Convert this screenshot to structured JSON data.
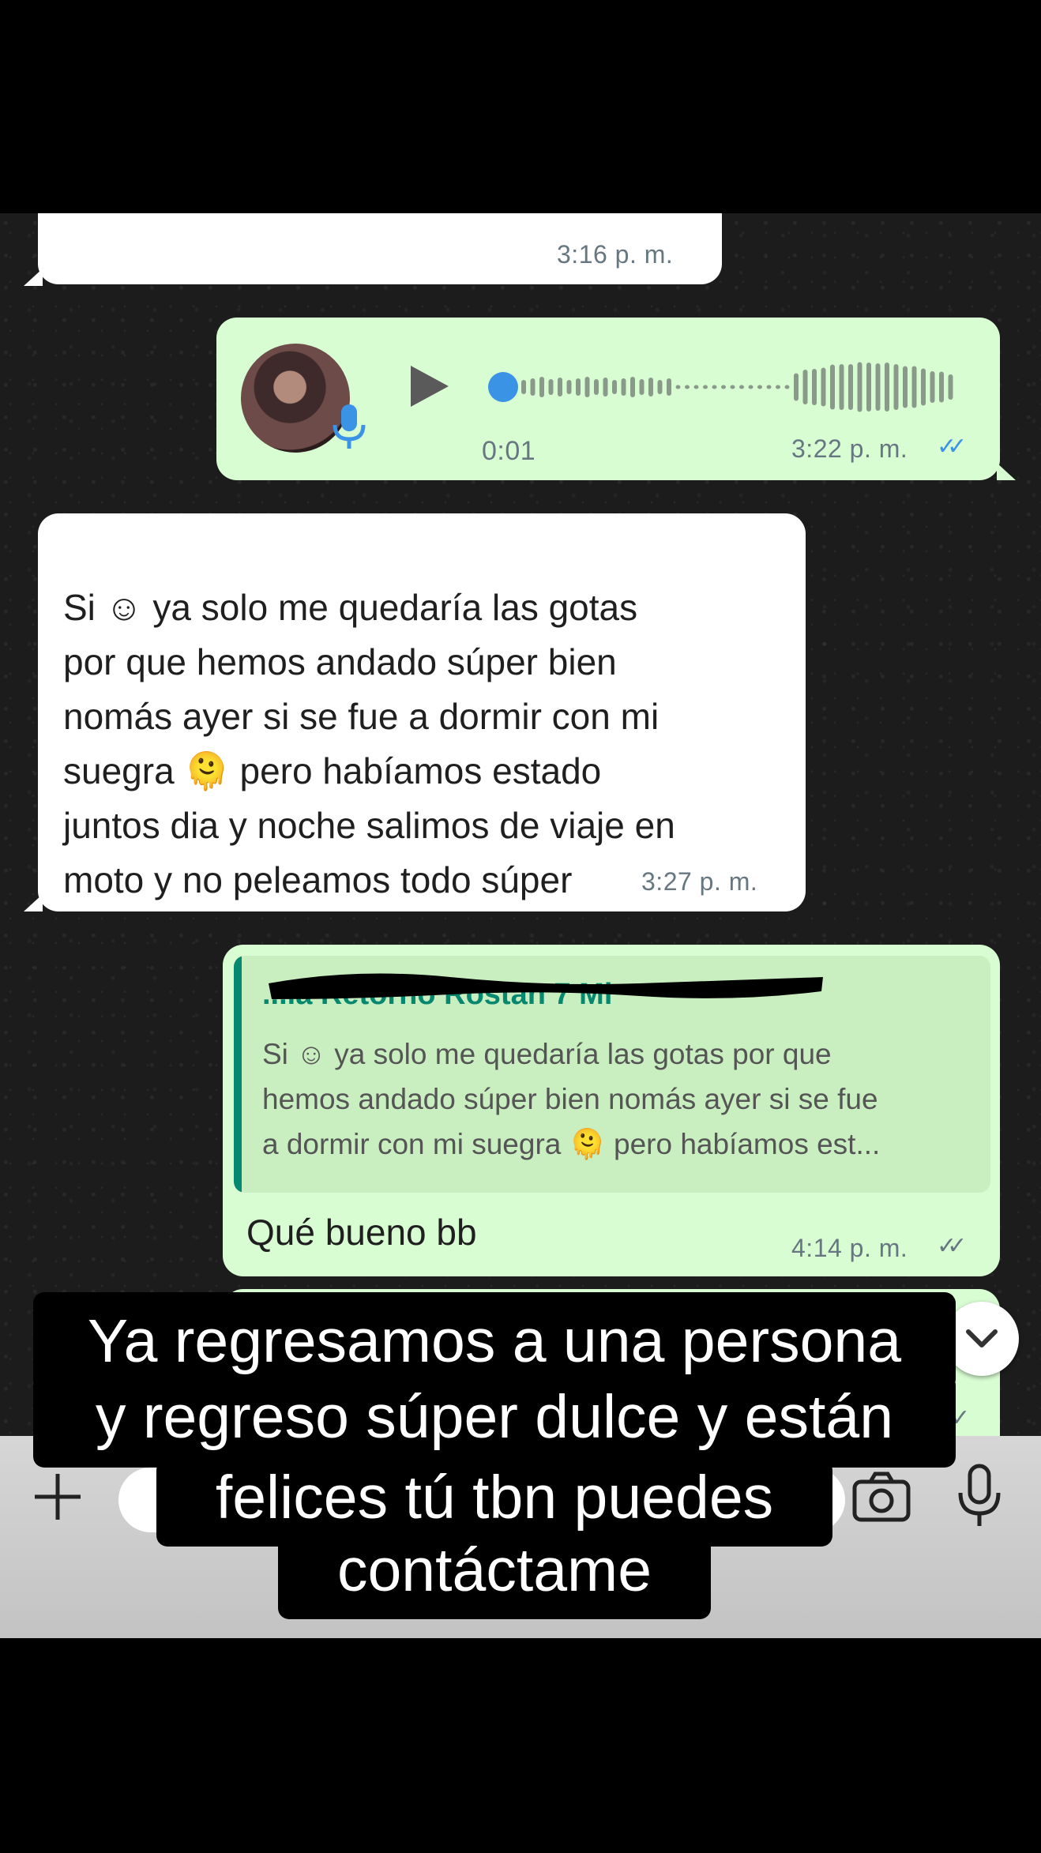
{
  "messages": [
    {
      "id": "m1",
      "direction": "in",
      "time": "3:16 p. m."
    },
    {
      "id": "m2",
      "direction": "out",
      "type": "voice",
      "duration": "0:01",
      "time": "3:22 p. m.",
      "read": true
    },
    {
      "id": "m3",
      "direction": "in",
      "text": "Si ☺ ya solo me quedaría las gotas\npor que hemos andado súper bien\nnomás ayer si se fue a dormir con mi\nsuegra 🫠 pero habíamos estado\njuntos dia y noche salimos de viaje en\nmoto y no peleamos todo súper",
      "time": "3:27 p. m."
    },
    {
      "id": "m4",
      "direction": "out",
      "reply": {
        "author": "...ia Retorno Rostan 7 Mi",
        "text": "Si ☺ ya solo me quedaría las gotas por que\nhemos andado súper bien nomás ayer si se fue\na dormir con mi suegra 🫠 pero habíamos est..."
      },
      "text": "Qué bueno bb",
      "time": "4:14 p. m."
    }
  ],
  "caption": {
    "lines": [
      "Ya regresamos a una persona",
      "y regreso súper dulce y están",
      "felices tú tbn puedes",
      "contáctame"
    ]
  },
  "input_bar": {
    "icons": [
      "plus-icon",
      "camera-icon",
      "microphone-icon"
    ]
  },
  "colors": {
    "incoming": "#ffffff",
    "outgoing": "#d9fdd3",
    "accent": "#06876f",
    "read_ticks": "#3b93e6",
    "delivered_ticks": "#667781"
  }
}
